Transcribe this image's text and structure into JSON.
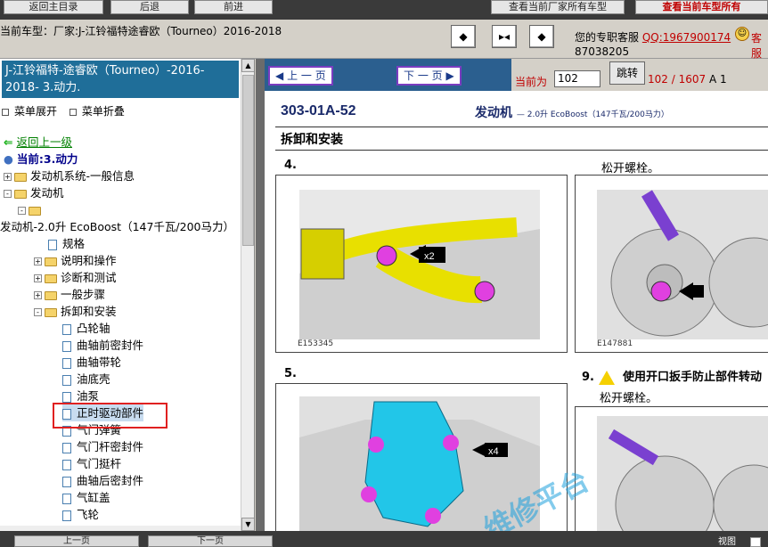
{
  "top_buttons": {
    "home": "返回主目录",
    "back": "后退",
    "forward": "前进",
    "view_all": "查看当前厂家所有车型",
    "view_current": "查看当前车型所有"
  },
  "header": {
    "model_label": "当前车型：厂家:J-江铃福特途睿欧（Tourneo）2016-2018",
    "nav_icons": [
      "first-page-icon",
      "split-view-icon",
      "last-page-icon"
    ],
    "service_label": "您的专职客服",
    "qq": "QQ:1967900174",
    "service_suffix": "客服",
    "phone": "87038205"
  },
  "left_panel": {
    "title": "J-江铃福特-途睿欧（Tourneo）-2016-2018- 3.动力.",
    "expand_all": "菜单展开",
    "collapse_all": "菜单折叠",
    "back_link": "返回上一级",
    "current": "当前:3.动力",
    "tree": [
      {
        "label": "发动机系统-一般信息",
        "type": "folder",
        "exp": "+"
      },
      {
        "label": "发动机",
        "type": "folder",
        "exp": "-"
      },
      {
        "label": "",
        "type": "folder",
        "exp": "-"
      },
      {
        "label": "发动机-2.0升 EcoBoost（147千瓦/200马力）",
        "type": "text",
        "exp": ""
      },
      {
        "label": "规格",
        "type": "doc",
        "exp": ""
      },
      {
        "label": "说明和操作",
        "type": "folder",
        "exp": "+"
      },
      {
        "label": "诊断和测试",
        "type": "folder",
        "exp": "+"
      },
      {
        "label": "一般步骤",
        "type": "folder",
        "exp": "+"
      },
      {
        "label": "拆卸和安装",
        "type": "folder",
        "exp": "-"
      },
      {
        "label": "凸轮轴",
        "type": "doc",
        "exp": ""
      },
      {
        "label": "曲轴前密封件",
        "type": "doc",
        "exp": ""
      },
      {
        "label": "曲轴带轮",
        "type": "doc",
        "exp": ""
      },
      {
        "label": "油底壳",
        "type": "doc",
        "exp": ""
      },
      {
        "label": "油泵",
        "type": "doc",
        "exp": ""
      },
      {
        "label": "正时驱动部件",
        "type": "doc",
        "exp": ""
      },
      {
        "label": "气门弹簧",
        "type": "doc",
        "exp": ""
      },
      {
        "label": "气门杆密封件",
        "type": "doc",
        "exp": ""
      },
      {
        "label": "气门挺杆",
        "type": "doc",
        "exp": ""
      },
      {
        "label": "曲轴后密封件",
        "type": "doc",
        "exp": ""
      },
      {
        "label": "气缸盖",
        "type": "doc",
        "exp": ""
      },
      {
        "label": "飞轮",
        "type": "doc",
        "exp": ""
      }
    ]
  },
  "right_panel": {
    "prev_page": "上 一 页",
    "next_page": "下 一 页",
    "goto_label": "当前为",
    "goto_value": "102",
    "goto_button": "跳转",
    "page_count": "102 / 1607",
    "page_suffix": "A 1"
  },
  "document": {
    "code": "303-01A-52",
    "title": "发动机",
    "subtitle": "— 2.0升 EcoBoost（147千瓦/200马力）",
    "section": "拆卸和安装",
    "step4": "4.",
    "step5": "5.",
    "step9": "9.",
    "note_loosen": "松开螺栓。",
    "note_warn": "使用开口扳手防止部件转动",
    "note_loosen2": "松开螺栓。",
    "fig1_code": "E153345",
    "fig2_code": "E147881",
    "callout_x2": "x2",
    "callout_x4": "x4",
    "watermark": "维修平台"
  },
  "bottom": {
    "btn1": "上一页",
    "btn2": "下一页",
    "view": "视图"
  },
  "colors": {
    "accent_blue": "#2b5f8f",
    "title_bg": "#1f6e99",
    "highlight_red": "#e02020",
    "part_yellow": "#e8e000",
    "part_cyan": "#22c6e8",
    "bolt_magenta": "#e040e0"
  }
}
